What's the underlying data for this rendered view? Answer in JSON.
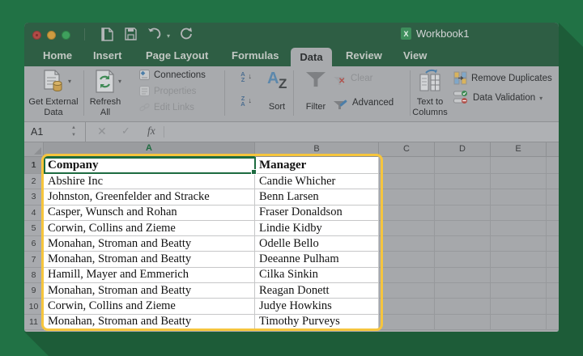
{
  "colors": {
    "excel_green": "#217245",
    "shadow_green": "#1D5C38",
    "titlebar_green": "#2E5E44",
    "annotation_yellow": "#F6C53D",
    "selection_green": "#1D6B40"
  },
  "titlebar": {
    "title": "Workbook1"
  },
  "tabs": [
    {
      "label": "Home",
      "active": false
    },
    {
      "label": "Insert",
      "active": false
    },
    {
      "label": "Page Layout",
      "active": false
    },
    {
      "label": "Formulas",
      "active": false
    },
    {
      "label": "Data",
      "active": true
    },
    {
      "label": "Review",
      "active": false
    },
    {
      "label": "View",
      "active": false
    }
  ],
  "ribbon": {
    "get_external_data": "Get External Data",
    "refresh_all": "Refresh All",
    "connections": "Connections",
    "properties": "Properties",
    "edit_links": "Edit Links",
    "sort": "Sort",
    "filter": "Filter",
    "clear": "Clear",
    "advanced": "Advanced",
    "text_to_columns": "Text to Columns",
    "remove_duplicates": "Remove Duplicates",
    "data_validation": "Data Validation"
  },
  "formula_bar": {
    "name_box": "A1",
    "cancel": "✕",
    "enter": "✓",
    "fx": "fx"
  },
  "sheet": {
    "col_headers": [
      "A",
      "B",
      "C",
      "D",
      "E"
    ],
    "active_cell": "A1",
    "rows": [
      {
        "n": "1",
        "company": "Company",
        "manager": "Manager"
      },
      {
        "n": "2",
        "company": "Abshire Inc",
        "manager": "Candie Whicher"
      },
      {
        "n": "3",
        "company": "Johnston, Greenfelder and Stracke",
        "manager": "Benn Larsen"
      },
      {
        "n": "4",
        "company": "Casper, Wunsch and Rohan",
        "manager": "Fraser Donaldson"
      },
      {
        "n": "5",
        "company": "Corwin, Collins and Zieme",
        "manager": "Lindie Kidby"
      },
      {
        "n": "6",
        "company": "Monahan, Stroman and Beatty",
        "manager": "Odelle Bello"
      },
      {
        "n": "7",
        "company": "Monahan, Stroman and Beatty",
        "manager": "Deeanne Pulham"
      },
      {
        "n": "8",
        "company": "Hamill, Mayer and Emmerich",
        "manager": "Cilka Sinkin"
      },
      {
        "n": "9",
        "company": "Monahan, Stroman and Beatty",
        "manager": "Reagan Donett"
      },
      {
        "n": "10",
        "company": "Corwin, Collins and Zieme",
        "manager": "Judye Howkins"
      },
      {
        "n": "11",
        "company": "Monahan, Stroman and Beatty",
        "manager": "Timothy Purveys"
      }
    ]
  }
}
